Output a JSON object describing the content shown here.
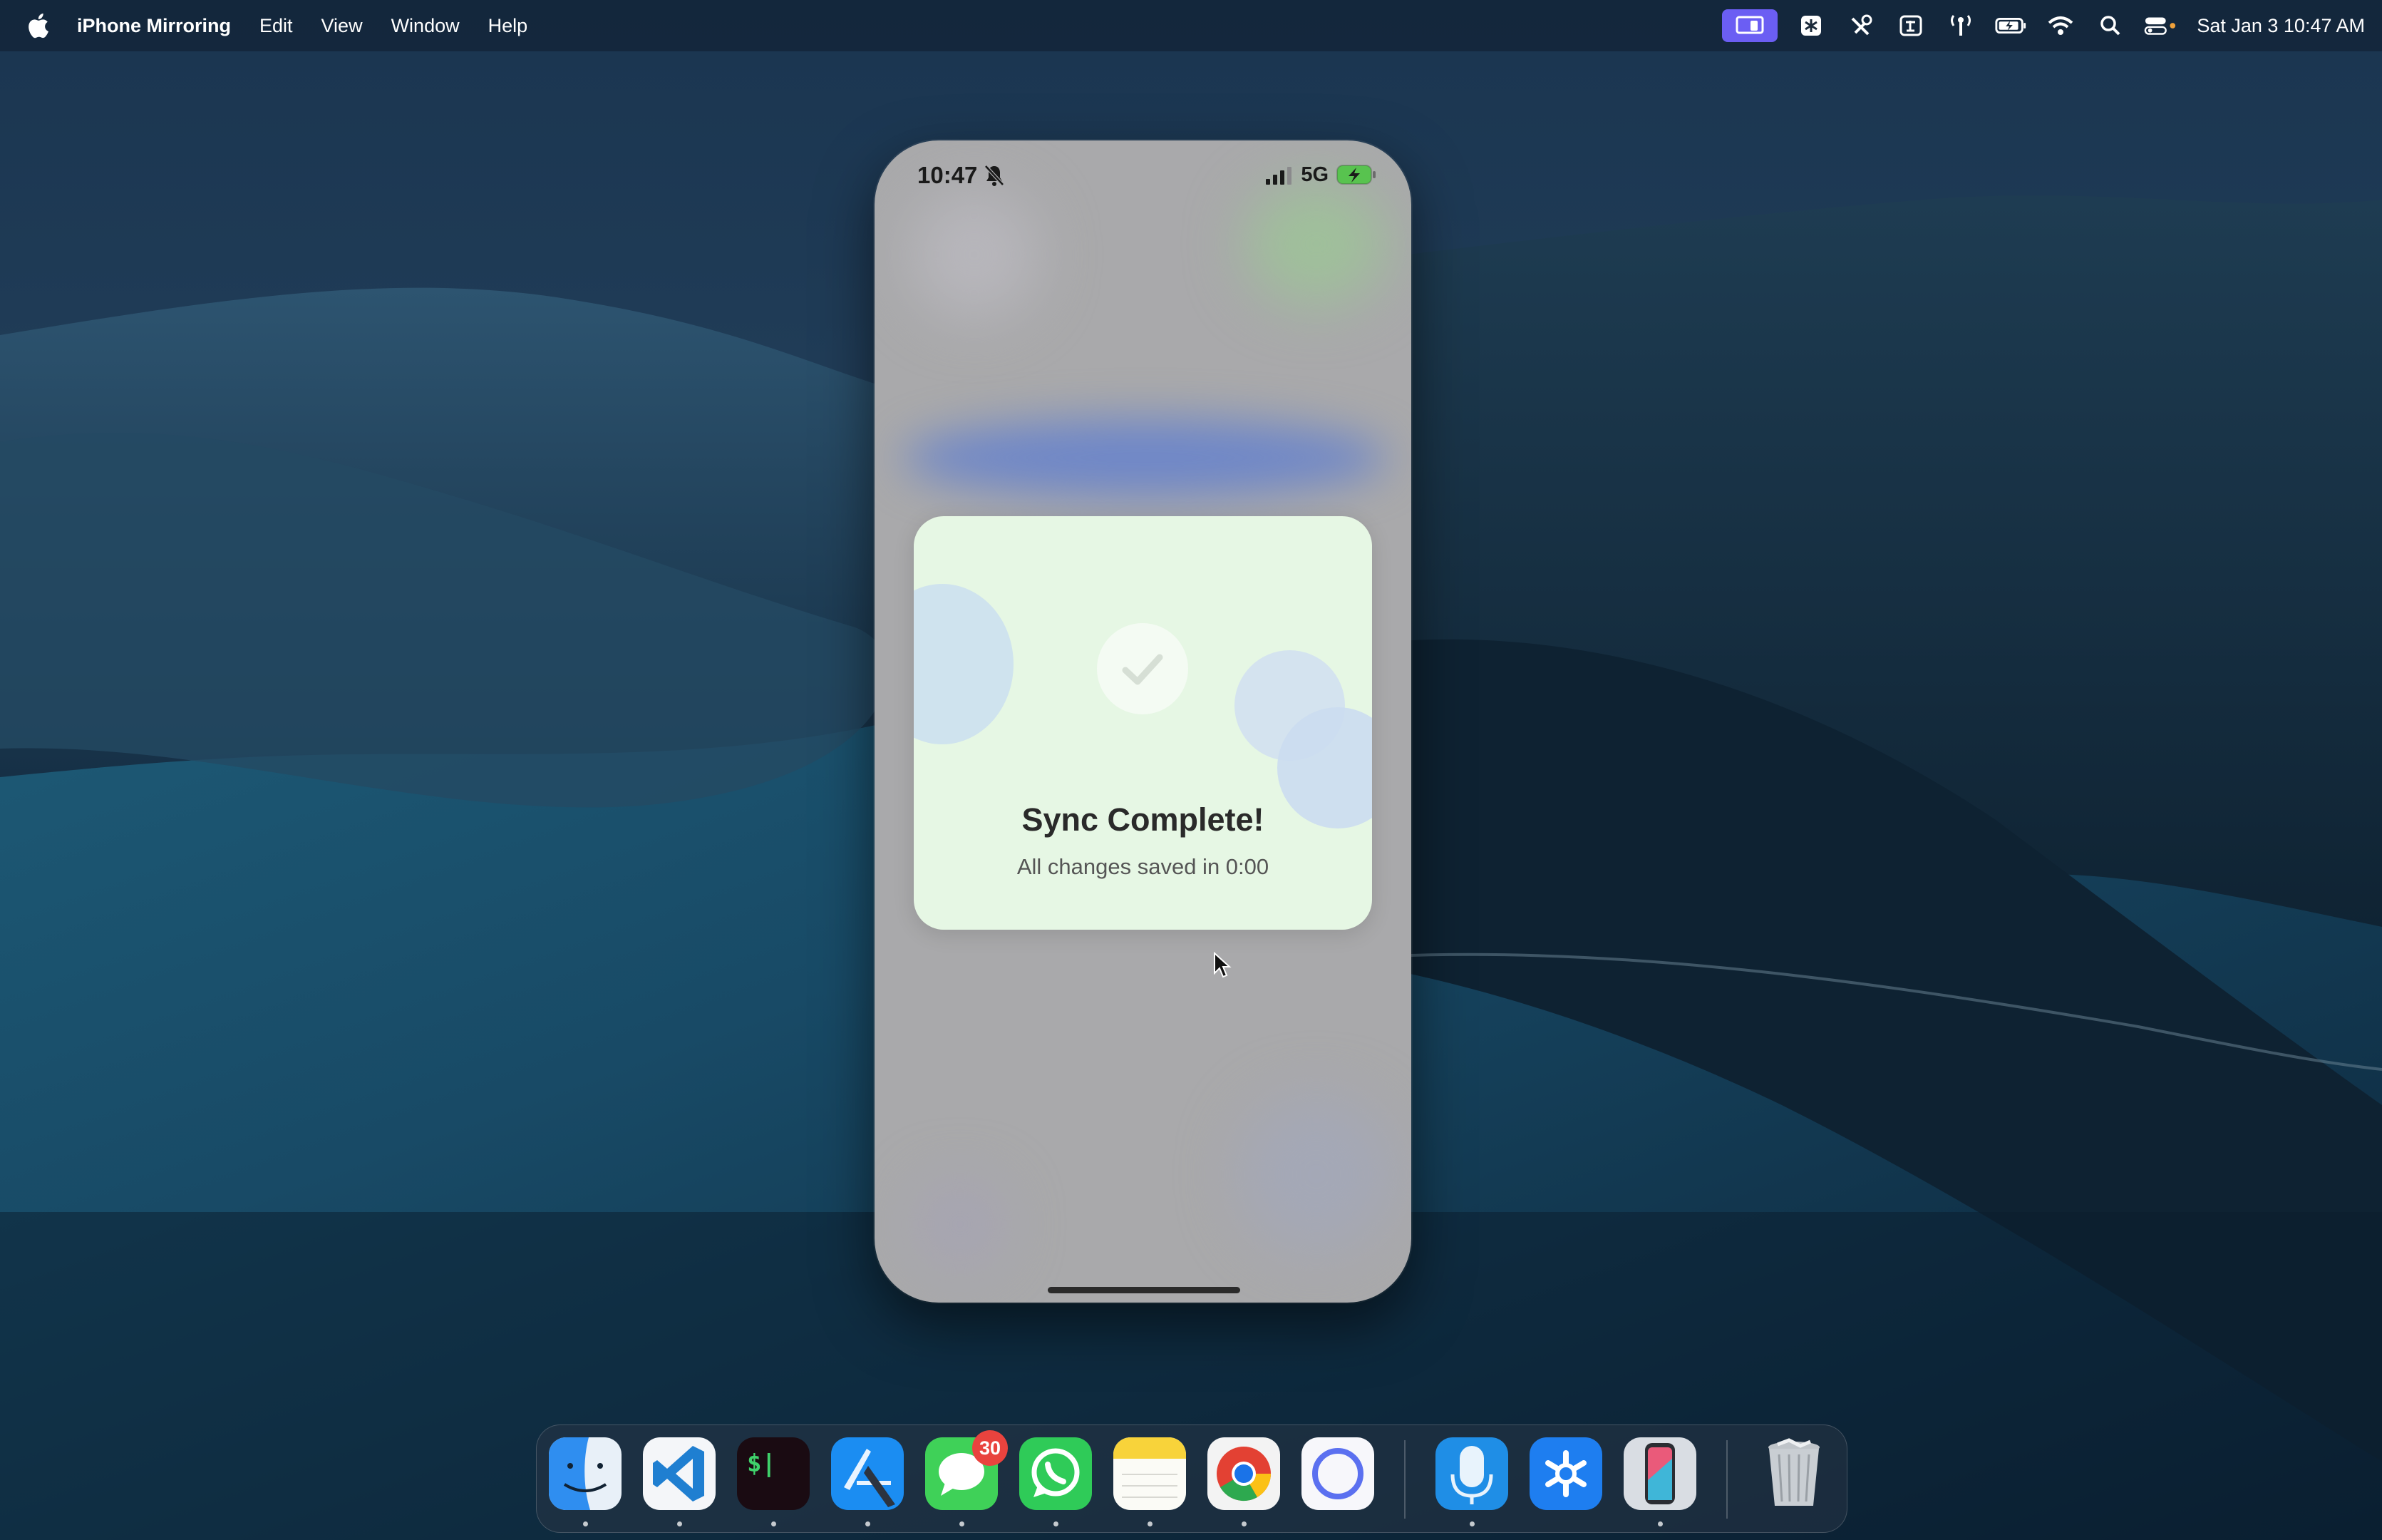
{
  "menubar": {
    "apple_icon": "apple-logo-icon",
    "app_name": "iPhone Mirroring",
    "menus": [
      "Edit",
      "View",
      "Window",
      "Help"
    ],
    "status_icons": [
      "iphone-mirroring-icon",
      "perplexity-icon",
      "tools-icon",
      "translate-icon",
      "antenna-icon",
      "battery-icon",
      "wifi-icon",
      "search-icon",
      "control-center-icon"
    ],
    "clock": "Sat Jan 3  10:47 AM"
  },
  "phone": {
    "status_bar": {
      "time": "10:47",
      "network": "5G",
      "silent": true
    },
    "card": {
      "title": "Sync Complete!",
      "subtitle": "All changes saved in 0:00",
      "icon": "checkmark-icon",
      "colors": {
        "card_bg": "#e6f7e4",
        "accent": "#cfe3ee"
      }
    }
  },
  "dock": {
    "apps": [
      "Finder",
      "Visual Studio Code",
      "Terminal",
      "Xcode",
      "Messages",
      "WhatsApp",
      "Notes",
      "Google Chrome",
      "Proton",
      "Voice Memos",
      "Perplexity",
      "iPhone Mirroring"
    ],
    "trash": "Trash",
    "messages_badge": "30"
  }
}
